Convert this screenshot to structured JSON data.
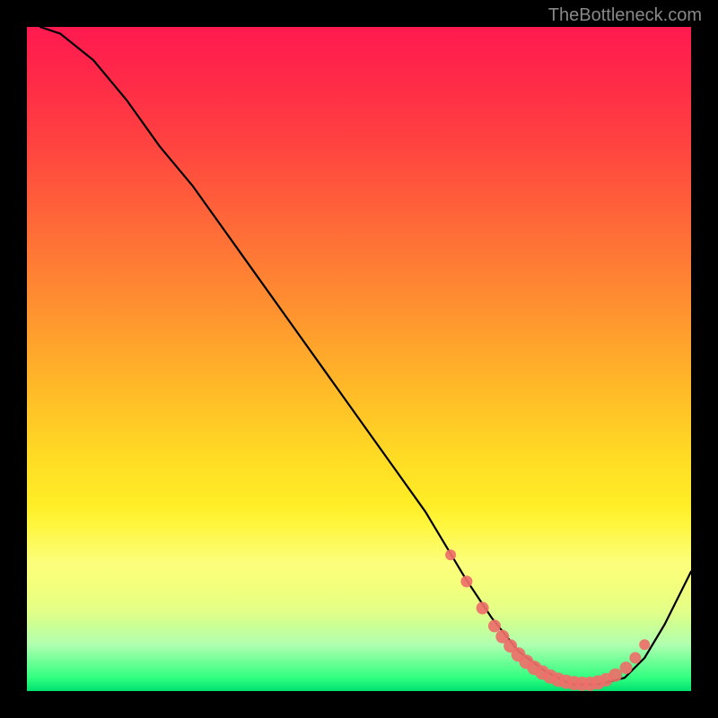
{
  "watermark": "TheBottleneck.com",
  "chart_data": {
    "type": "line",
    "title": "",
    "xlabel": "",
    "ylabel": "",
    "xlim": [
      0,
      100
    ],
    "ylim": [
      0,
      100
    ],
    "grid": false,
    "legend_position": "none",
    "series": [
      {
        "name": "curve",
        "x": [
          2,
          5,
          10,
          15,
          20,
          25,
          30,
          35,
          40,
          45,
          50,
          55,
          60,
          63,
          66,
          70,
          74,
          78,
          82,
          86,
          90,
          93,
          96,
          100
        ],
        "y": [
          100,
          99,
          95,
          89,
          82,
          76,
          69,
          62,
          55,
          48,
          41,
          34,
          27,
          22,
          17,
          11,
          6,
          3,
          1,
          1,
          2,
          5,
          10,
          18
        ]
      }
    ],
    "markers": {
      "name": "highlight-dots",
      "color": "#ee6f6a",
      "x": [
        63.8,
        66.2,
        68.6,
        70.4,
        71.6,
        72.8,
        74.0,
        75.2,
        76.4,
        77.6,
        78.8,
        80.0,
        81.2,
        82.4,
        83.6,
        84.8,
        86.0,
        87.2,
        88.6,
        90.2,
        91.6,
        93.0
      ],
      "y": [
        20.5,
        16.5,
        12.5,
        9.8,
        8.2,
        6.8,
        5.5,
        4.4,
        3.5,
        2.8,
        2.2,
        1.7,
        1.4,
        1.2,
        1.1,
        1.1,
        1.3,
        1.7,
        2.4,
        3.5,
        5.0,
        7.0
      ],
      "size": [
        6,
        6.5,
        7,
        7,
        7.5,
        7.5,
        8,
        8,
        8,
        8,
        8,
        8,
        8,
        8,
        8,
        8,
        8,
        7.5,
        7.5,
        7,
        6.5,
        6
      ]
    },
    "background_gradient": {
      "top": "#ff1a50",
      "mid": "#ffe028",
      "bottom": "#00e070"
    }
  }
}
